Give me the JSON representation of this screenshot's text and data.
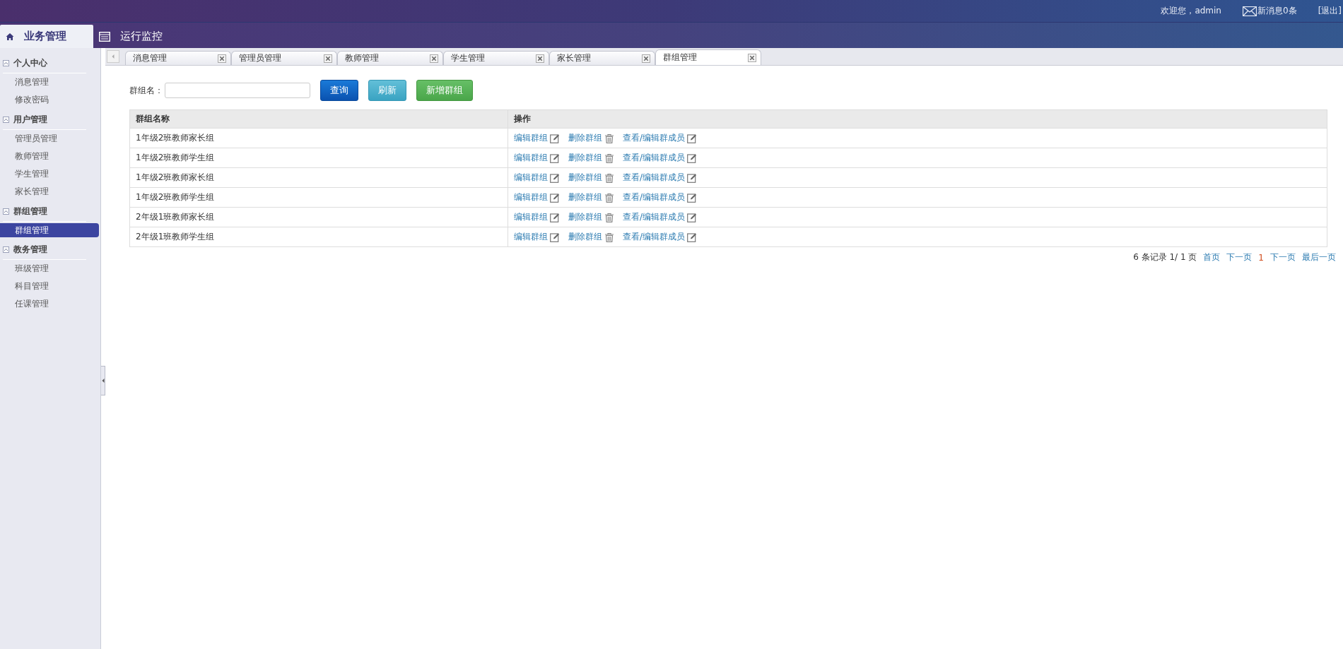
{
  "header": {
    "welcome": "欢迎您，admin",
    "messages": "新消息0条",
    "logout": "[退出]"
  },
  "nav_tabs": [
    {
      "label": "业务管理",
      "selected": true
    },
    {
      "label": "运行监控",
      "selected": false
    }
  ],
  "sidebar": {
    "groups": [
      {
        "title": "个人中心",
        "expanded": true,
        "items": [
          {
            "label": "消息管理",
            "selected": false
          },
          {
            "label": "修改密码",
            "selected": false
          }
        ]
      },
      {
        "title": "用户管理",
        "expanded": true,
        "items": [
          {
            "label": "管理员管理",
            "selected": false
          },
          {
            "label": "教师管理",
            "selected": false
          },
          {
            "label": "学生管理",
            "selected": false
          },
          {
            "label": "家长管理",
            "selected": false
          }
        ]
      },
      {
        "title": "群组管理",
        "expanded": true,
        "items": [
          {
            "label": "群组管理",
            "selected": true
          }
        ]
      },
      {
        "title": "教务管理",
        "expanded": true,
        "items": [
          {
            "label": "班级管理",
            "selected": false
          },
          {
            "label": "科目管理",
            "selected": false
          },
          {
            "label": "任课管理",
            "selected": false
          }
        ]
      }
    ]
  },
  "tabs": [
    {
      "label": "消息管理",
      "selected": false
    },
    {
      "label": "管理员管理",
      "selected": false
    },
    {
      "label": "教师管理",
      "selected": false
    },
    {
      "label": "学生管理",
      "selected": false
    },
    {
      "label": "家长管理",
      "selected": false
    },
    {
      "label": "群组管理",
      "selected": true
    }
  ],
  "filter": {
    "label": "群组名：",
    "buttons": [
      {
        "label": "查询",
        "kind": "primary"
      },
      {
        "label": "刷新",
        "kind": "info"
      },
      {
        "label": "新增群组",
        "kind": "success"
      }
    ]
  },
  "table": {
    "columns": [
      "群组名称",
      "操作"
    ],
    "rows": [
      {
        "name": "1年级2班教师家长组",
        "actions": [
          "编辑群组",
          "删除群组",
          "查看/编辑群成员"
        ]
      },
      {
        "name": "1年级2班教师学生组",
        "actions": [
          "编辑群组",
          "删除群组",
          "查看/编辑群成员"
        ]
      },
      {
        "name": "1年级2班教师家长组",
        "actions": [
          "编辑群组",
          "删除群组",
          "查看/编辑群成员"
        ]
      },
      {
        "name": "1年级2班教师学生组",
        "actions": [
          "编辑群组",
          "删除群组",
          "查看/编辑群成员"
        ]
      },
      {
        "name": "2年级1班教师家长组",
        "actions": [
          "编辑群组",
          "删除群组",
          "查看/编辑群成员"
        ]
      },
      {
        "name": "2年级1班教师学生组",
        "actions": [
          "编辑群组",
          "删除群组",
          "查看/编辑群成员"
        ]
      }
    ]
  },
  "pagination": {
    "summary": "6 条记录 1/ 1 页",
    "links": [
      {
        "label": "首页",
        "kind": "link"
      },
      {
        "label": "下一页",
        "kind": "link"
      },
      {
        "label": "1",
        "kind": "current"
      },
      {
        "label": "下一页",
        "kind": "link"
      },
      {
        "label": "最后一页",
        "kind": "link"
      }
    ]
  }
}
